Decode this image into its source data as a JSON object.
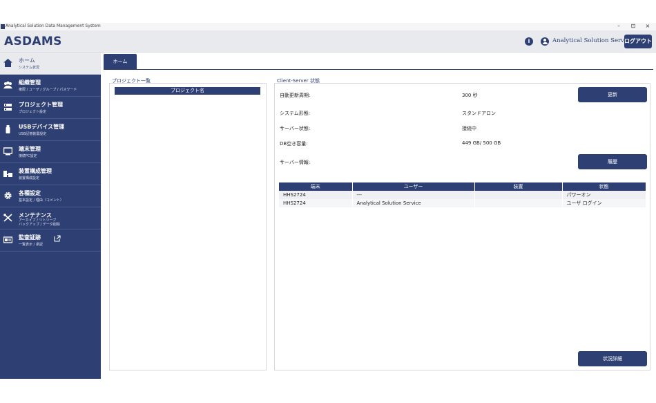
{
  "window": {
    "title": "Analytical Solution Data Management System",
    "controls": {
      "minimize": "–",
      "maximize": "⊡",
      "close": "×"
    }
  },
  "header": {
    "brand": "ASDAMS",
    "info_icon": "i",
    "user_name": "Analytical Solution Service",
    "logout_label": "ログアウト"
  },
  "sidebar": {
    "items": [
      {
        "title": "ホーム",
        "sub": "システム状況",
        "sub2": "",
        "icon": "home-icon"
      },
      {
        "title": "組織管理",
        "sub": "権限 / ユーザ / グループ / パスワード",
        "sub2": "",
        "icon": "users-icon"
      },
      {
        "title": "プロジェクト管理",
        "sub": "プロジェクト設定",
        "sub2": "",
        "icon": "project-icon"
      },
      {
        "title": "USBデバイス管理",
        "sub": "USB記憶装置設定",
        "sub2": "",
        "icon": "usb-icon"
      },
      {
        "title": "端末管理",
        "sub": "接続PC設定",
        "sub2": "",
        "icon": "monitor-icon"
      },
      {
        "title": "装置構成管理",
        "sub": "装置構成設定",
        "sub2": "",
        "icon": "device-config-icon"
      },
      {
        "title": "各種設定",
        "sub": "基本設定 / 理由（コメント）",
        "sub2": "",
        "icon": "gear-icon"
      },
      {
        "title": "メンテナンス",
        "sub": "アーカイブ / リトリーブ",
        "sub2": "バックアップ / データ削除",
        "icon": "tools-icon"
      },
      {
        "title": "監査証跡",
        "sub": "一覧表示 / 承認",
        "sub2": "",
        "icon": "audit-icon"
      }
    ]
  },
  "tabs": {
    "home": "ホーム"
  },
  "project_list": {
    "label": "プロジェクト一覧",
    "column": "プロジェクト名"
  },
  "client_server": {
    "label": "Client-Server 状態",
    "auto_refresh_key": "自動更新周期:",
    "auto_refresh_val": "300 秒",
    "system_form_key": "システム形態:",
    "system_form_val": "スタンドアロン",
    "server_state_key": "サーバー状態:",
    "server_state_val": "接続中",
    "db_free_key": "DB空き容量:",
    "db_free_val": "449 GB/ 500 GB",
    "server_info_key": "サーバー情報:",
    "refresh_button": "更新",
    "history_button": "履歴",
    "detail_button": "状況詳細",
    "table": {
      "headers": [
        "端末",
        "ユーザー",
        "装置",
        "状態"
      ],
      "rows": [
        [
          "HHS2724",
          "---",
          "",
          "パワーオン"
        ],
        [
          "HHS2724",
          "Analytical Solution Service",
          "",
          "ユーザ ログイン"
        ]
      ]
    }
  }
}
